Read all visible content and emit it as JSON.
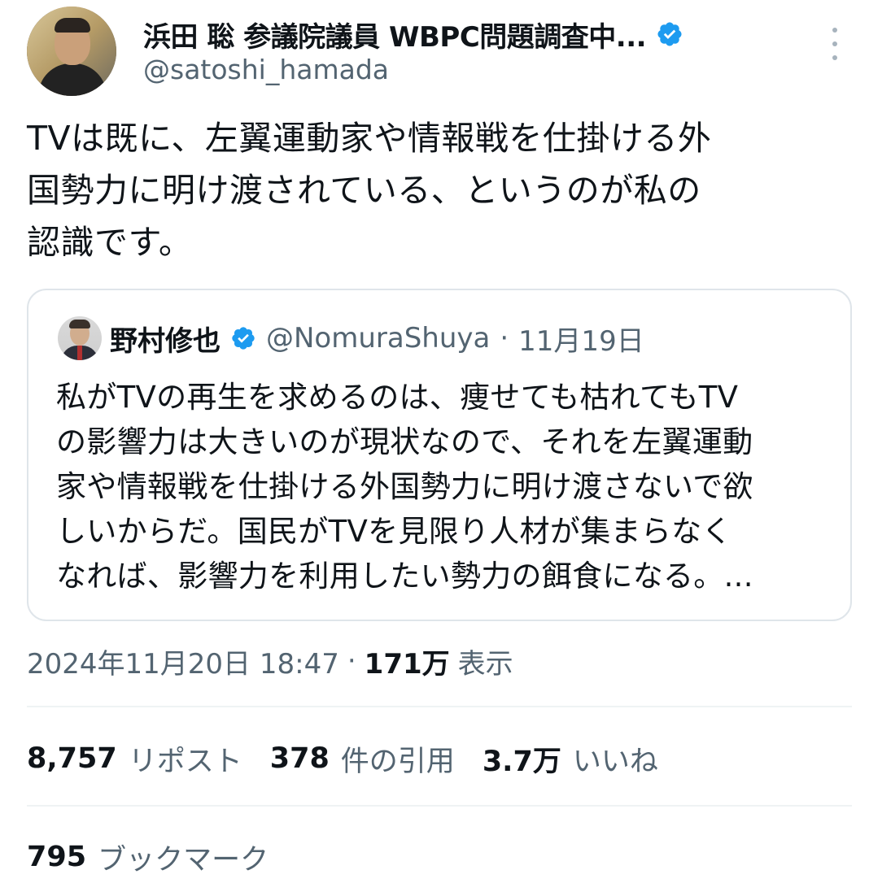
{
  "author": {
    "display_name": "浜田 聡 参議院議員 WBPC問題調査中...",
    "handle": "@satoshi_hamada",
    "avatar_icon": "profile-photo",
    "verified_icon": "verified-badge-icon"
  },
  "tweet": {
    "lines": [
      "TVは既に、左翼運動家や情報戦を仕掛ける外",
      "国勢力に明け渡されている、というのが私の",
      "認識です。"
    ]
  },
  "quote": {
    "display_name": "野村修也",
    "handle": "@NomuraShuya",
    "separator": "·",
    "date": "11月19日",
    "lines": [
      "私がTVの再生を求めるのは、痩せても枯れてもTV",
      "の影響力は大きいのが現状なので、それを左翼運動",
      "家や情報戦を仕掛ける外国勢力に明け渡さないで欲",
      "しいからだ。国民がTVを見限り人材が集まらなく",
      "なれば、影響力を利用したい勢力の餌食になる。..."
    ]
  },
  "meta": {
    "timestamp": "2024年11月20日 18:47",
    "separator": "·",
    "views_count": "171万",
    "views_label": "表示"
  },
  "stats": {
    "reposts": {
      "count": "8,757",
      "label": "リポスト"
    },
    "quotes": {
      "count": "378",
      "label": "件の引用"
    },
    "likes": {
      "count": "3.7万",
      "label": "いいね"
    },
    "bookmarks": {
      "count": "795",
      "label": "ブックマーク"
    }
  },
  "colors": {
    "primary_text": "#0f1419",
    "secondary_text": "#536471",
    "verified_blue": "#1d9bf0",
    "border": "#dfe5ea"
  }
}
